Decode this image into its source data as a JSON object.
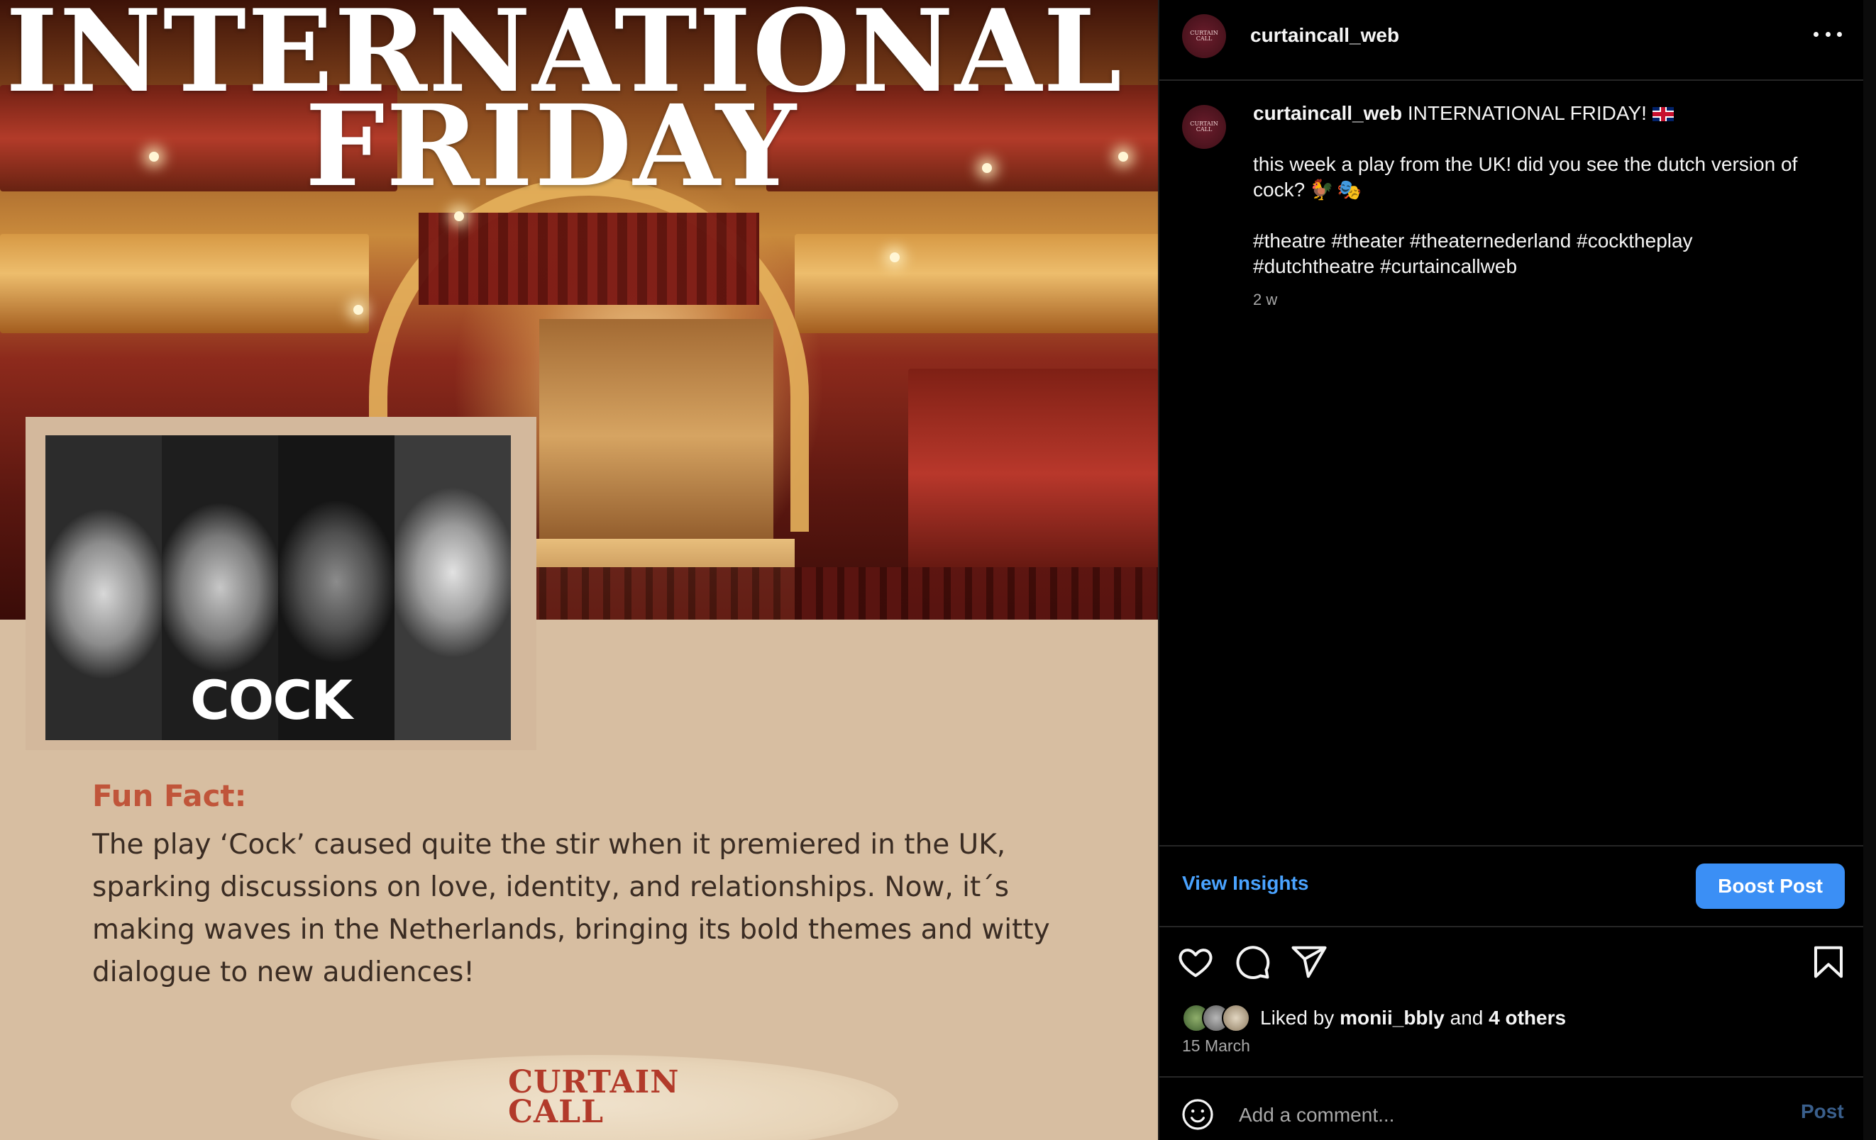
{
  "post_image": {
    "title_line1": "INTERNATIONAL",
    "title_line2": "FRIDAY",
    "cast_title": "COCK",
    "fun_fact_title": "Fun Fact:",
    "fun_fact_text": "The play ‘Cock’ caused quite the stir when it premiered in the UK, sparking discussions on love, identity, and relationships. Now, it´s making waves in the Netherlands, bringing its bold themes and witty dialogue to new audiences!",
    "logo_line1": "CURTAIN",
    "logo_line2": "CALL",
    "colors": {
      "background": "#d7bea1",
      "fun_fact_title": "#c0553a",
      "logo": "#b23a2a"
    }
  },
  "header": {
    "username": "curtaincall_web",
    "avatar_text": "CURTAIN CALL",
    "more_icon": "more-horizontal-icon"
  },
  "caption": {
    "username": "curtaincall_web",
    "headline": "INTERNATIONAL FRIDAY!",
    "headline_emoji": "flag-uk",
    "body": "this week a play from the UK! did you see the dutch version of cock?",
    "body_emojis": [
      "rooster",
      "performing-arts-masks"
    ],
    "hashtags_line1": "#theatre #theater #theaternederland #cocktheplay",
    "hashtags_line2": "#dutchtheatre #curtaincallweb",
    "time_ago": "2 w"
  },
  "actions": {
    "view_insights": "View Insights",
    "boost_post": "Boost Post",
    "icons": [
      "heart-icon",
      "comment-icon",
      "share-icon",
      "bookmark-icon"
    ]
  },
  "likes": {
    "prefix": "Liked by",
    "user": "monii_bbly",
    "conjunction": "and",
    "others": "4 others",
    "date": "15 March"
  },
  "comment": {
    "placeholder": "Add a comment...",
    "post_label": "Post"
  },
  "colors": {
    "accent_blue": "#3b8ff5",
    "link_blue": "#4aa3ff",
    "sidebar_bg": "#000000",
    "muted_text": "#a8a8a8"
  }
}
